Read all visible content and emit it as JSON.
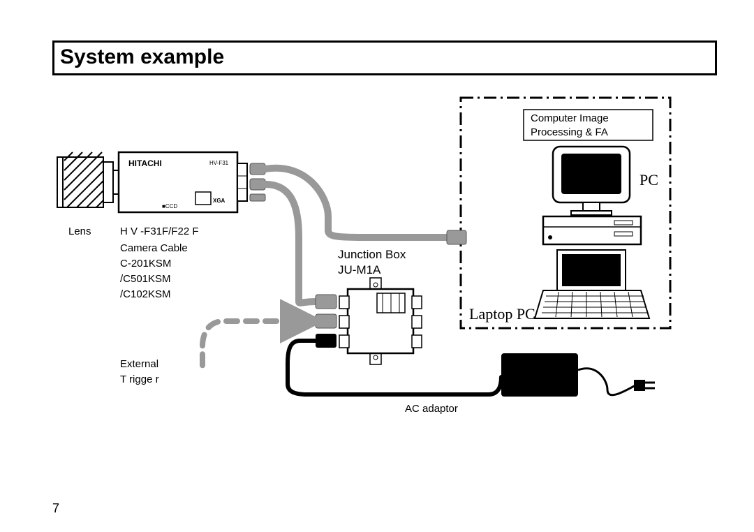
{
  "title": "System example",
  "labels": {
    "lens": "Lens",
    "camera_model": "H V -F31F/F22      F",
    "camera_cable": "Camera Cable",
    "cable1": "C-201KSM",
    "cable2": "/C501KSM",
    "cable3": "/C102KSM",
    "external": "External",
    "trigger": "T rigge   r",
    "junction_box": "Junction Box",
    "junction_model": "JU-M1A",
    "ac_adaptor": "AC adaptor",
    "comp_img1": "Computer Image",
    "comp_img2": "Processing &      FA",
    "pc": "PC",
    "laptop": "Laptop PC",
    "cam_brand": "HITACHI",
    "cam_badge": "HV-F31"
  },
  "page": "7"
}
